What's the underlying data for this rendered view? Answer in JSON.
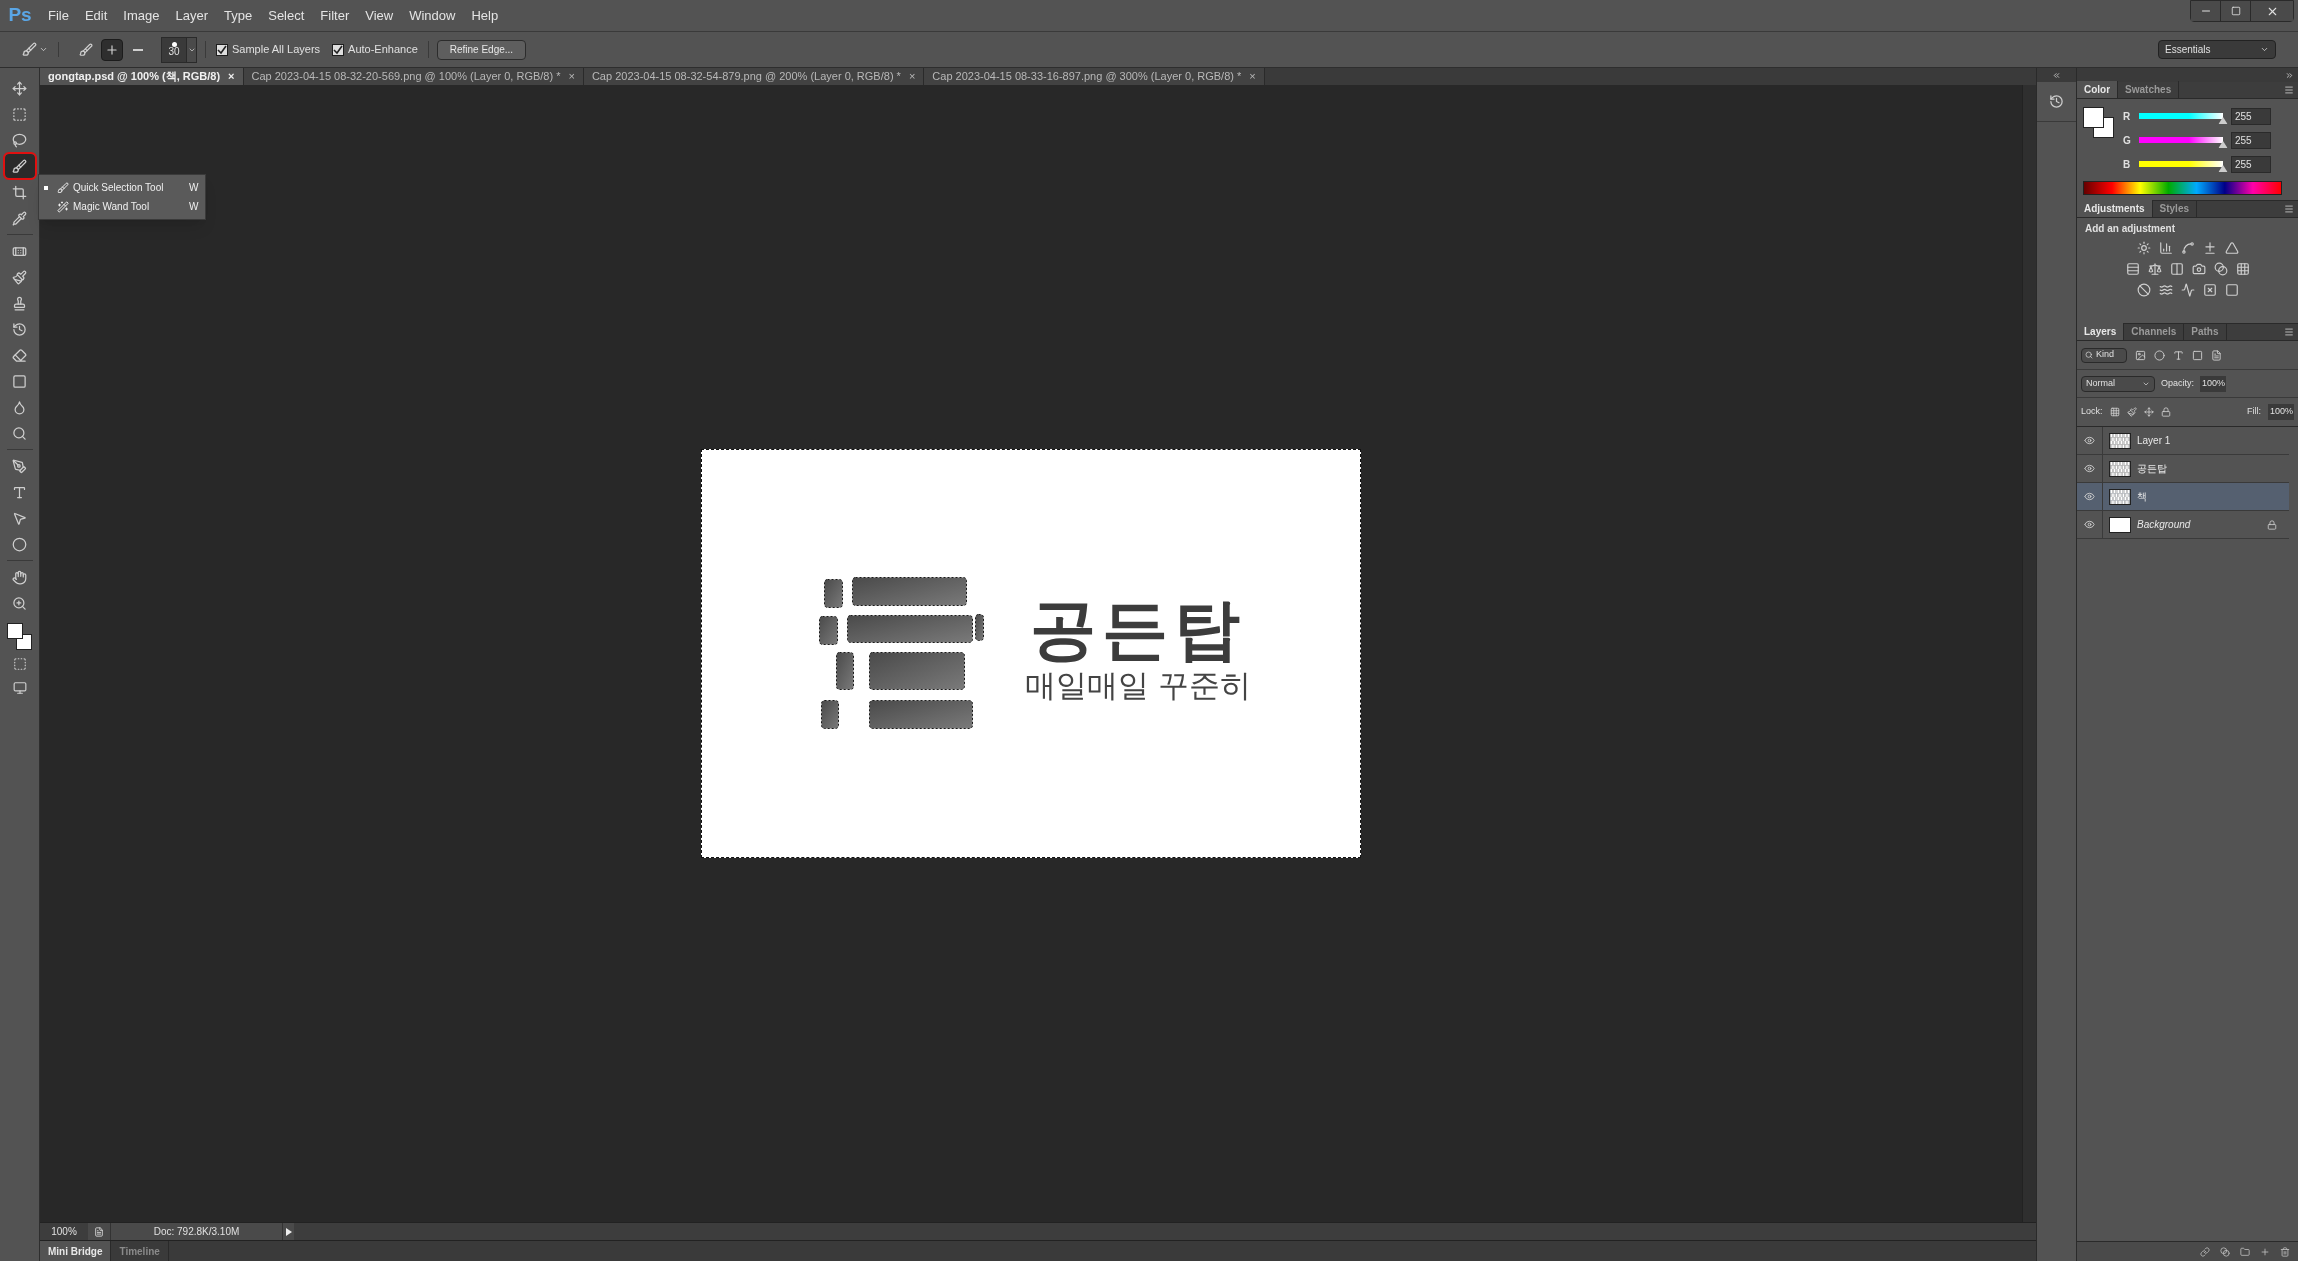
{
  "app": {
    "logo": "Ps"
  },
  "menu": [
    "File",
    "Edit",
    "Image",
    "Layer",
    "Type",
    "Select",
    "Filter",
    "View",
    "Window",
    "Help"
  ],
  "options_bar": {
    "brush_size": "30",
    "selection_modes": [
      {
        "kind": "new",
        "selected": false
      },
      {
        "kind": "add",
        "selected": true
      },
      {
        "kind": "subtract",
        "selected": false
      }
    ],
    "checkboxes": [
      {
        "label": "Sample All Layers",
        "checked": true
      },
      {
        "label": "Auto-Enhance",
        "checked": true
      }
    ],
    "refine_button": "Refine Edge...",
    "workspace": "Essentials"
  },
  "document_tabs": [
    {
      "label": "gongtap.psd @ 100% (책, RGB/8)",
      "close": "×",
      "selected": true
    },
    {
      "label": "Cap 2023-04-15 08-32-20-569.png @ 100% (Layer 0, RGB/8) *",
      "close": "×",
      "selected": false
    },
    {
      "label": "Cap 2023-04-15 08-32-54-879.png @ 200% (Layer 0, RGB/8) *",
      "close": "×",
      "selected": false
    },
    {
      "label": "Cap 2023-04-15 08-33-16-897.png @ 300% (Layer 0, RGB/8) *",
      "close": "×",
      "selected": false
    }
  ],
  "tools": [
    {
      "kind": "move",
      "selected": false
    },
    {
      "kind": "marquee",
      "selected": false
    },
    {
      "kind": "lasso",
      "selected": false
    },
    {
      "kind": "quick_selection",
      "selected": true
    },
    {
      "kind": "crop",
      "selected": false
    },
    {
      "kind": "eyedropper",
      "selected": false
    },
    {
      "kind": "healing",
      "selected": false
    },
    {
      "kind": "brush",
      "selected": false
    },
    {
      "kind": "stamp",
      "selected": false
    },
    {
      "kind": "history_brush",
      "selected": false
    },
    {
      "kind": "eraser",
      "selected": false
    },
    {
      "kind": "gradient",
      "selected": false
    },
    {
      "kind": "blur",
      "selected": false
    },
    {
      "kind": "dodge",
      "selected": false
    },
    {
      "kind": "pen",
      "selected": false
    },
    {
      "kind": "type",
      "selected": false
    },
    {
      "kind": "path_selection",
      "selected": false
    },
    {
      "kind": "ellipse",
      "selected": false
    },
    {
      "kind": "hand",
      "selected": false
    },
    {
      "kind": "zoom",
      "selected": false
    }
  ],
  "tool_flyout": [
    {
      "label": "Quick Selection Tool",
      "shortcut": "W",
      "selected": true
    },
    {
      "label": "Magic Wand Tool",
      "shortcut": "W",
      "selected": false
    }
  ],
  "canvas": {
    "title": "공든탑",
    "subtitle": "매일매일 꾸준히"
  },
  "color_panel": {
    "tabs": [
      {
        "label": "Color",
        "selected": true
      },
      {
        "label": "Swatches",
        "selected": false
      }
    ],
    "channels": [
      {
        "name": "R",
        "value": "255",
        "level": 1,
        "color": "#00ffff"
      },
      {
        "name": "G",
        "value": "255",
        "level": 1,
        "color": "#ff00ff"
      },
      {
        "name": "B",
        "value": "255",
        "level": 1,
        "color": "#ffff00"
      }
    ]
  },
  "adjustments_panel": {
    "tabs": [
      {
        "label": "Adjustments",
        "selected": true
      },
      {
        "label": "Styles",
        "selected": false
      }
    ],
    "heading": "Add an adjustment"
  },
  "layers_panel": {
    "tabs": [
      {
        "label": "Layers",
        "selected": true
      },
      {
        "label": "Channels",
        "selected": false
      },
      {
        "label": "Paths",
        "selected": false
      }
    ],
    "filter": "Kind",
    "blend_mode": "Normal",
    "opacity_label": "Opacity:",
    "opacity": "100%",
    "lock_label": "Lock:",
    "fill_label": "Fill:",
    "fill": "100%",
    "layers": [
      {
        "name": "Layer 1",
        "kind": "transparent",
        "visible": true,
        "locked": false,
        "selected": false
      },
      {
        "name": "공든탑",
        "kind": "transparent",
        "visible": true,
        "locked": false,
        "selected": false
      },
      {
        "name": "책",
        "kind": "transparent",
        "visible": true,
        "locked": false,
        "selected": true
      },
      {
        "name": "Background",
        "kind": "background",
        "visible": true,
        "locked": true,
        "selected": false
      }
    ]
  },
  "status_bar": {
    "zoom": "100%",
    "doc": "Doc: 792.8K/3.10M"
  },
  "bottom_tabs": [
    {
      "label": "Mini Bridge",
      "selected": true
    },
    {
      "label": "Timeline",
      "selected": false
    }
  ]
}
